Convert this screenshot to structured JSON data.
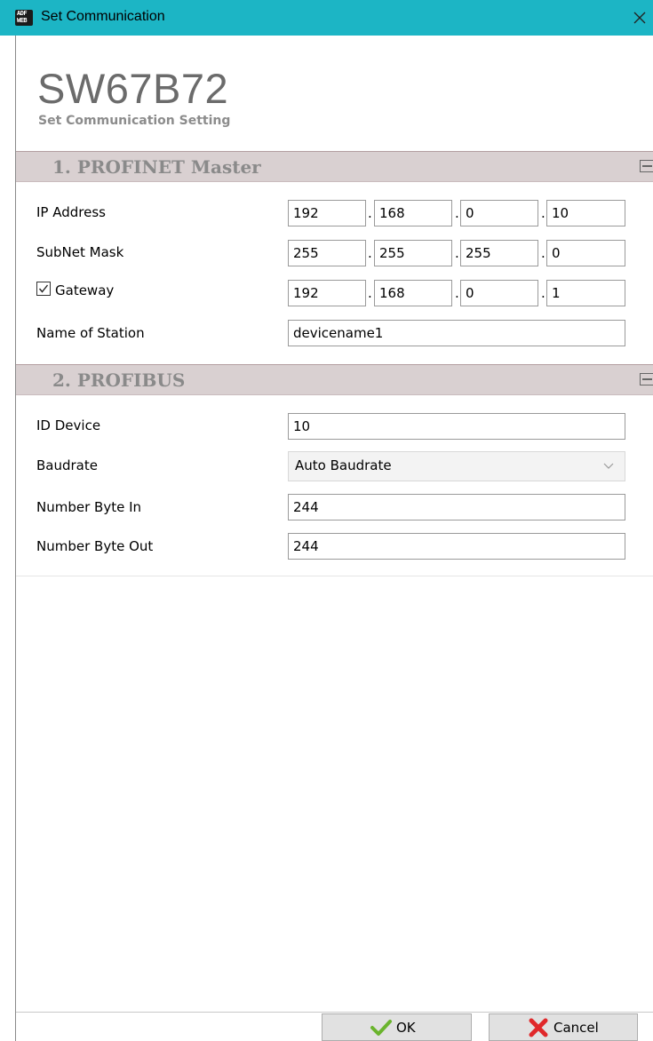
{
  "window": {
    "title": "Set Communication",
    "icon_line1": "ADF",
    "icon_line2": "WEB"
  },
  "header": {
    "product": "SW67B72",
    "subtitle": "Set Communication Setting"
  },
  "sections": [
    {
      "title": "1. PROFINET Master",
      "ip_address": {
        "label": "IP Address",
        "octets": [
          "192",
          "168",
          "0",
          "10"
        ]
      },
      "subnet_mask": {
        "label": "SubNet Mask",
        "octets": [
          "255",
          "255",
          "255",
          "0"
        ]
      },
      "gateway": {
        "label": "Gateway",
        "checked": true,
        "octets": [
          "192",
          "168",
          "0",
          "1"
        ]
      },
      "name_of_station": {
        "label": "Name of Station",
        "value": "devicename1"
      }
    },
    {
      "title": "2. PROFIBUS",
      "id_device": {
        "label": "ID Device",
        "value": "10"
      },
      "baudrate": {
        "label": "Baudrate",
        "value": "Auto Baudrate"
      },
      "number_byte_in": {
        "label": "Number Byte In",
        "value": "244"
      },
      "number_byte_out": {
        "label": "Number Byte Out",
        "value": "244"
      }
    }
  ],
  "footer": {
    "ok_label": "OK",
    "cancel_label": "Cancel"
  },
  "icons": {
    "ok": "check-icon",
    "cancel": "x-icon",
    "close": "close-icon",
    "collapse": "collapse-icon",
    "dropdown": "chevron-down-icon"
  },
  "colors": {
    "titlebar": "#1cb5c5",
    "section_header": "#d9d0d1",
    "check_green": "#6ab42d",
    "cancel_red": "#e0282a"
  }
}
